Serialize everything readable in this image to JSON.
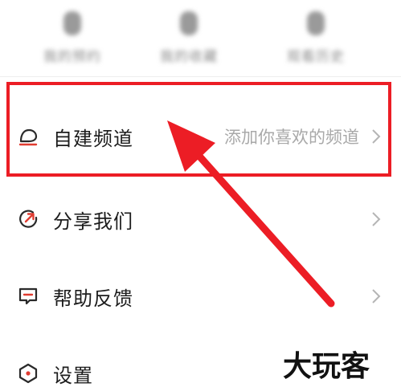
{
  "stats": {
    "items": [
      {
        "label": "我的预约"
      },
      {
        "label": "我的收藏"
      },
      {
        "label": "观看历史"
      }
    ]
  },
  "menu": {
    "create_channel": {
      "label": "自建频道",
      "hint": "添加你喜欢的频道",
      "icon": "bell-outline-icon"
    },
    "share": {
      "label": "分享我们",
      "icon": "share-circle-arrow-icon"
    },
    "help": {
      "label": "帮助反馈",
      "icon": "feedback-chat-icon"
    },
    "settings": {
      "label": "设置",
      "icon": "settings-hexagon-icon"
    }
  },
  "annotation": {
    "highlight_color": "#ec1d25",
    "arrow_color": "#ec1d25"
  },
  "watermark": {
    "text": "大玩客"
  },
  "colors": {
    "accent": "#e03c31",
    "text": "#1c1c1c",
    "hint": "#a9a9a9",
    "chevron": "#b5b5b5"
  }
}
